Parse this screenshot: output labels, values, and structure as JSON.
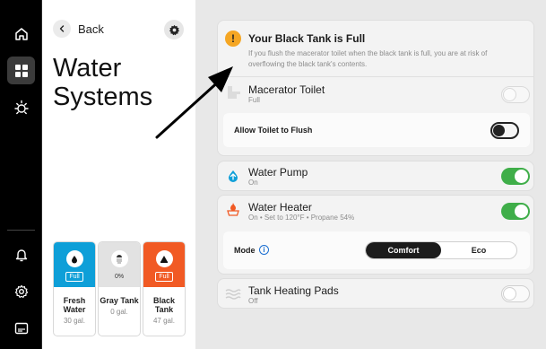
{
  "rail": {
    "items": [
      {
        "icon": "home-icon"
      },
      {
        "icon": "grid-icon",
        "active": true
      },
      {
        "icon": "sun-icon"
      }
    ],
    "bottom_items": [
      {
        "icon": "bell-icon"
      },
      {
        "icon": "settings-icon"
      },
      {
        "icon": "display-icon"
      }
    ]
  },
  "nav": {
    "back_label": "Back"
  },
  "page": {
    "title": "Water Systems"
  },
  "tanks": [
    {
      "name": "Fresh Water",
      "level": "Full",
      "capacity": "30 gal.",
      "color": "#0e9fd8",
      "icon": "water-drop-icon"
    },
    {
      "name": "Gray Tank",
      "level": "0%",
      "capacity": "0 gal.",
      "color": "#e2e2e2",
      "icon": "gray-water-icon"
    },
    {
      "name": "Black Tank",
      "level": "Full",
      "capacity": "47 gal.",
      "color": "#f15a24",
      "icon": "black-tank-icon"
    }
  ],
  "alert": {
    "title": "Your Black Tank is Full",
    "body": "If you flush the macerator toilet when the black tank is full, you are at risk of overflowing the black tank's contents.",
    "color": "#f5a623"
  },
  "macerator": {
    "title": "Macerator Toilet",
    "status": "Full",
    "toggle": "off"
  },
  "allow_flush": {
    "label": "Allow Toilet to Flush",
    "toggle": "off"
  },
  "water_pump": {
    "title": "Water Pump",
    "status": "On",
    "toggle": "on"
  },
  "water_heater": {
    "title": "Water Heater",
    "status": "On • Set to 120°F • Propane 54%",
    "toggle": "on"
  },
  "mode": {
    "label": "Mode",
    "options": [
      "Comfort",
      "Eco"
    ],
    "selected": "Comfort"
  },
  "heating_pads": {
    "title": "Tank Heating Pads",
    "status": "Off",
    "toggle": "off"
  },
  "colors": {
    "accent_green": "#3fae49",
    "pump_blue": "#0e9fd8",
    "heater_orange": "#f15a24"
  }
}
